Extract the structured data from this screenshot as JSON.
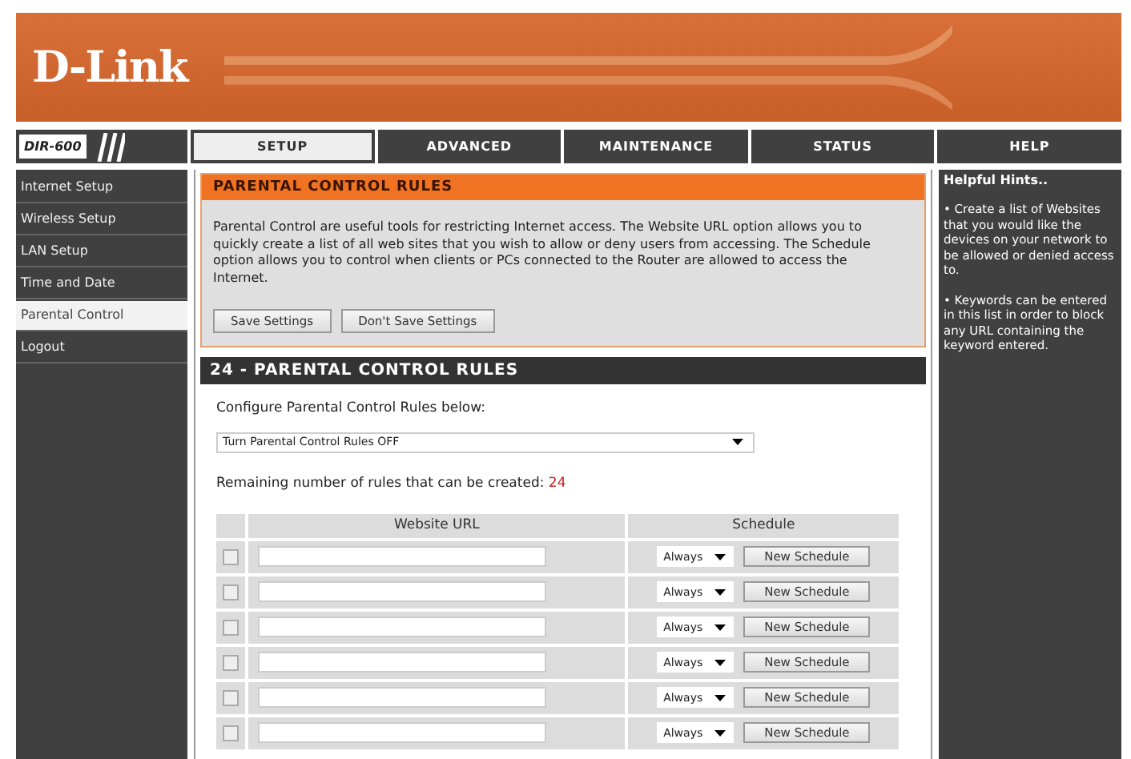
{
  "header": {
    "logo": "D-Link"
  },
  "model": "DIR-600",
  "tabs": [
    {
      "label": "SETUP",
      "selected": true
    },
    {
      "label": "ADVANCED",
      "selected": false
    },
    {
      "label": "MAINTENANCE",
      "selected": false
    },
    {
      "label": "STATUS",
      "selected": false
    },
    {
      "label": "HELP",
      "selected": false
    }
  ],
  "sidebar": {
    "items": [
      {
        "label": "Internet Setup",
        "selected": false
      },
      {
        "label": "Wireless Setup",
        "selected": false
      },
      {
        "label": "LAN Setup",
        "selected": false
      },
      {
        "label": "Time and Date",
        "selected": false
      },
      {
        "label": "Parental Control",
        "selected": true
      },
      {
        "label": "Logout",
        "selected": false
      }
    ]
  },
  "intro": {
    "title": "PARENTAL CONTROL RULES",
    "text": "Parental Control are useful tools for restricting Internet access. The Website URL option allows you to quickly create a list of all web sites that you wish to allow or deny users from accessing. The Schedule option allows you to control when clients or PCs connected to the Router are allowed to access the Internet.",
    "buttons": [
      "Save Settings",
      "Don't Save Settings"
    ]
  },
  "rules": {
    "title": "24 - PARENTAL CONTROL RULES",
    "configure_label": "Configure Parental Control Rules below:",
    "mode_select": "Turn Parental Control Rules OFF",
    "remaining_label": "Remaining number of rules that can be created:",
    "remaining_count": "24",
    "columns": [
      "Website URL",
      "Schedule"
    ],
    "rows": [
      {
        "checked": false,
        "schedule": "Always",
        "button": "New Schedule"
      },
      {
        "checked": false,
        "schedule": "Always",
        "button": "New Schedule"
      },
      {
        "checked": false,
        "schedule": "Always",
        "button": "New Schedule"
      },
      {
        "checked": false,
        "schedule": "Always",
        "button": "New Schedule"
      },
      {
        "checked": false,
        "schedule": "Always",
        "button": "New Schedule"
      },
      {
        "checked": false,
        "schedule": "Always",
        "button": "New Schedule"
      }
    ]
  },
  "hints": {
    "title": "Helpful Hints..",
    "items": [
      "• Create a list of Websites that you would like the devices on your network to be allowed or denied access to.",
      "• Keywords can be entered in this list in order to block any URL containing the keyword entered."
    ]
  }
}
